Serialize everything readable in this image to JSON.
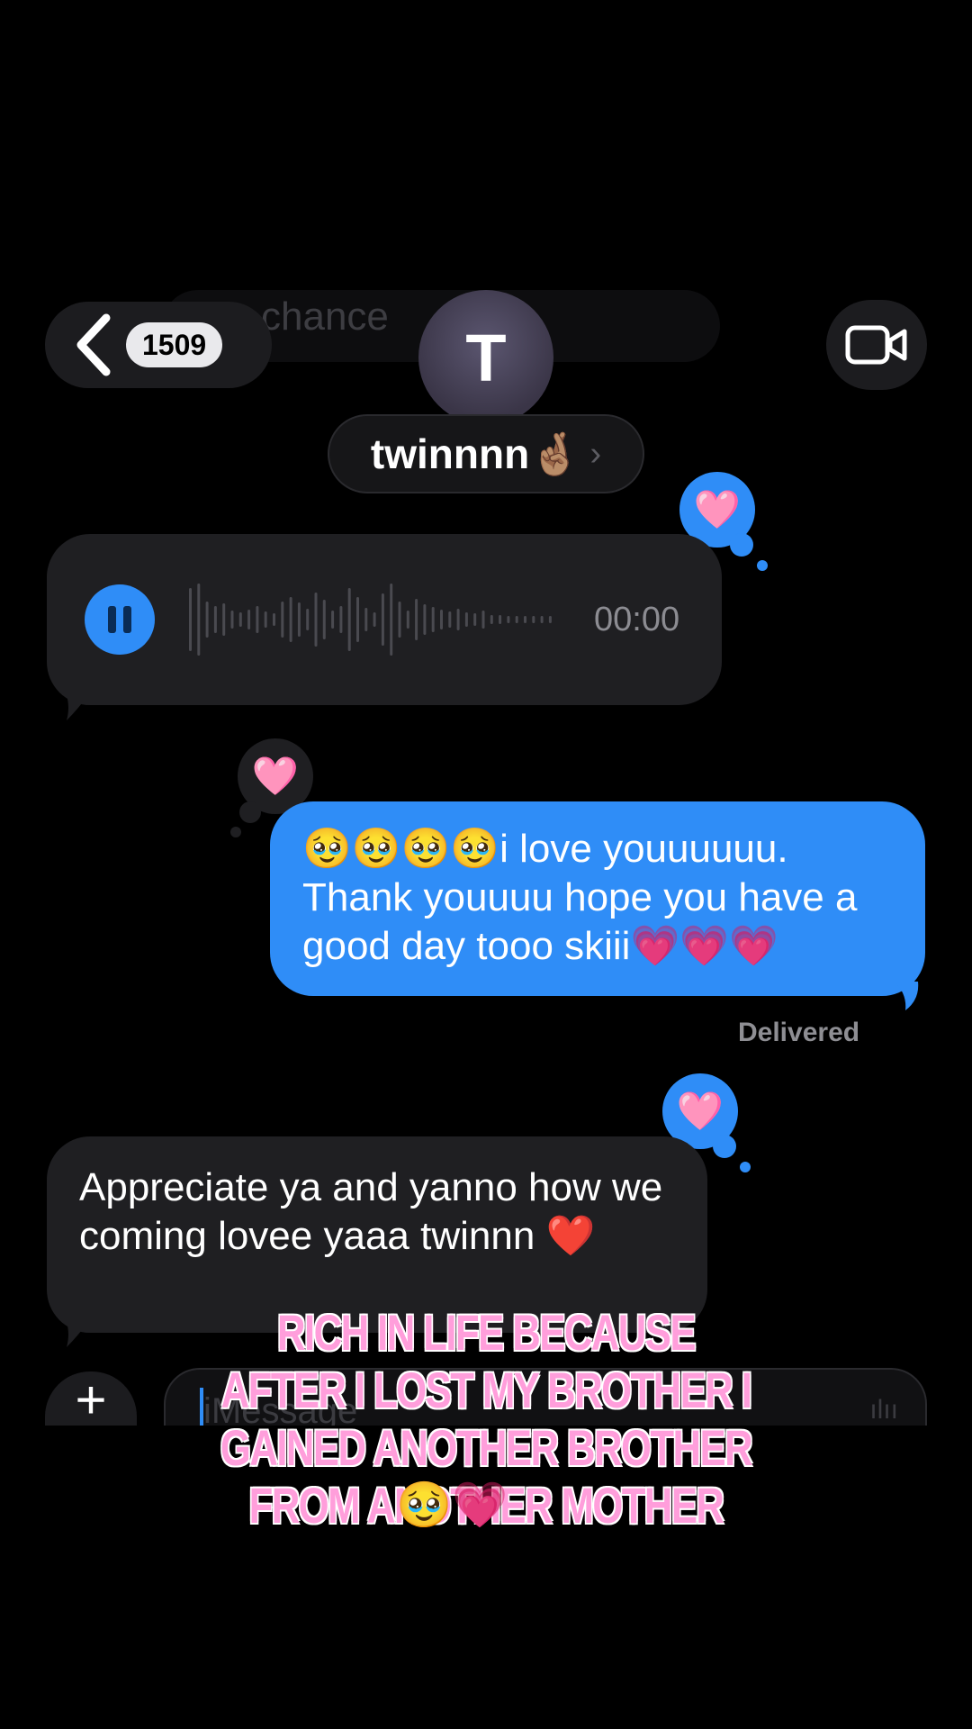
{
  "nav": {
    "ghost_text": "chance",
    "badge": "1509"
  },
  "contact": {
    "initial": "T",
    "name": "twinnnn🤞🏽",
    "chevron": "›"
  },
  "messages": {
    "audio_reaction": "🩷",
    "audio_time": "00:00",
    "sent_reaction": "🩷",
    "sent_text": "🥹🥹🥹🥹i love youuuuuu. Thank youuuu hope you have a good day tooo skiii💗💗💗",
    "delivered": "Delivered",
    "received_reaction": "🩷",
    "received_text": "Appreciate ya and yanno how we coming lovee yaaa twinnn ❤️"
  },
  "composer": {
    "plus": "+",
    "placeholder": "iMessage",
    "mic": "ılıı"
  },
  "caption": {
    "text": "RICH IN LIFE BECAUSE AFTER I LOST MY BROTHER I GAINED ANOTHER BROTHER FROM ANOTHER MOTHER",
    "emoji": "🥹💗"
  },
  "colors": {
    "background": "#000000",
    "sent_bubble": "#2f8df7",
    "received_bubble": "#1f1f22",
    "caption": "#ff9edb"
  }
}
